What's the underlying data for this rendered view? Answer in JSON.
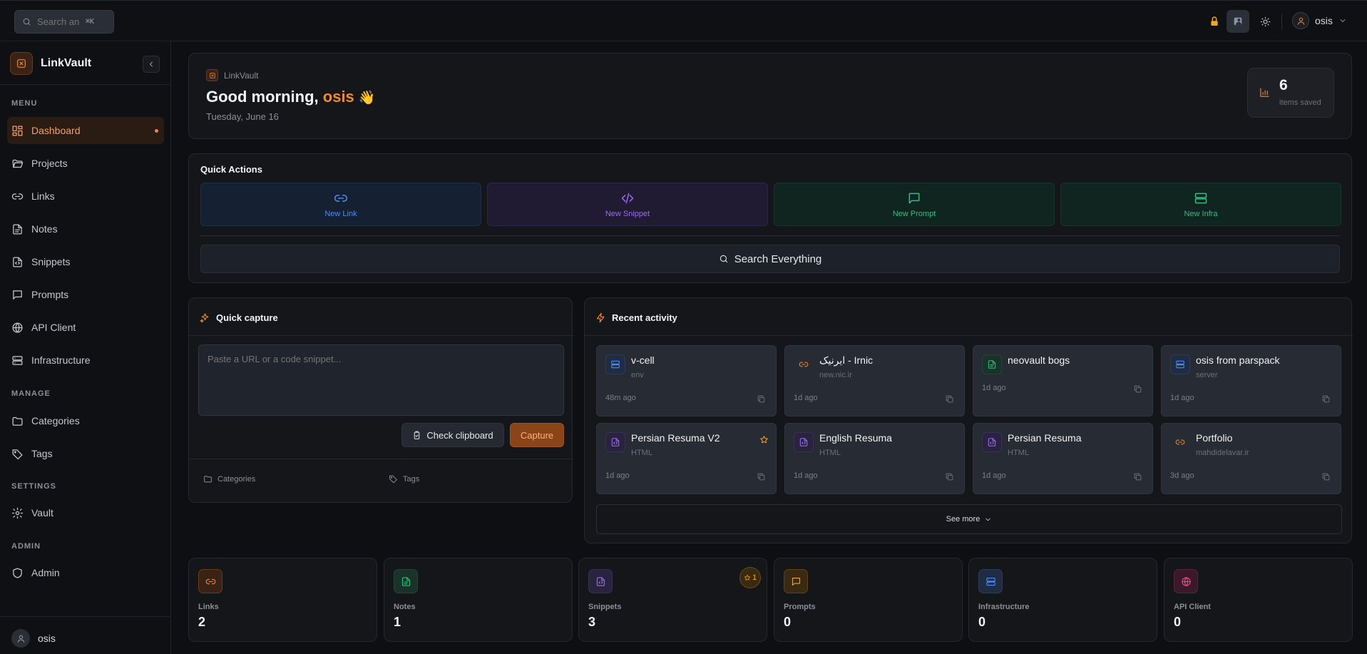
{
  "topbar": {
    "search_placeholder": "Search an",
    "search_kbd": "⌘K",
    "user_name": "osis"
  },
  "sidebar": {
    "brand": "LinkVault",
    "sections": {
      "menu": "MENU",
      "manage": "MANAGE",
      "settings": "SETTINGS",
      "admin": "ADMIN"
    },
    "items": {
      "dashboard": "Dashboard",
      "projects": "Projects",
      "links": "Links",
      "notes": "Notes",
      "snippets": "Snippets",
      "prompts": "Prompts",
      "api_client": "API Client",
      "infrastructure": "Infrastructure",
      "categories": "Categories",
      "tags": "Tags",
      "vault": "Vault",
      "admin": "Admin"
    },
    "user_name": "osis"
  },
  "hero": {
    "crumb": "LinkVault",
    "greeting": "Good morning, ",
    "name": "osis",
    "wave": "👋",
    "date": "Tuesday, June 16",
    "saved_count": "6",
    "saved_label": "items saved"
  },
  "quick_actions": {
    "title": "Quick Actions",
    "new_link": "New Link",
    "new_snippet": "New Snippet",
    "new_prompt": "New Prompt",
    "new_infra": "New Infra",
    "search_everything": "Search Everything"
  },
  "quick_capture": {
    "title": "Quick capture",
    "placeholder": "Paste a URL or a code snippet...",
    "check_clipboard": "Check clipboard",
    "capture": "Capture",
    "categories": "Categories",
    "tags": "Tags"
  },
  "recent_activity": {
    "title": "Recent activity",
    "items": [
      {
        "title": "v-cell",
        "sub": "env",
        "time": "48m ago",
        "icon": "server-icon",
        "color": "blue"
      },
      {
        "title": "ایرنیک - Irnic",
        "sub": "new.nic.ir",
        "time": "1d ago",
        "icon": "link-icon",
        "color": "orange"
      },
      {
        "title": "neovault bogs",
        "sub": "",
        "time": "1d ago",
        "icon": "document-icon",
        "color": "green"
      },
      {
        "title": "osis from parspack",
        "sub": "server",
        "time": "1d ago",
        "icon": "server-icon",
        "color": "blue"
      },
      {
        "title": "Persian Resuma V2",
        "sub": "HTML",
        "time": "1d ago",
        "icon": "code-file-icon",
        "color": "purple",
        "starred": true
      },
      {
        "title": "English Resuma",
        "sub": "HTML",
        "time": "1d ago",
        "icon": "code-file-icon",
        "color": "purple"
      },
      {
        "title": "Persian Resuma",
        "sub": "HTML",
        "time": "1d ago",
        "icon": "code-file-icon",
        "color": "purple"
      },
      {
        "title": "Portfolio",
        "sub": "mahdidelavar.ir",
        "time": "3d ago",
        "icon": "link-icon",
        "color": "orange"
      }
    ],
    "see_more": "See more"
  },
  "stats": [
    {
      "label": "Links",
      "value": "2",
      "icon": "link-icon",
      "color": "orange"
    },
    {
      "label": "Notes",
      "value": "1",
      "icon": "document-icon",
      "color": "green"
    },
    {
      "label": "Snippets",
      "value": "3",
      "icon": "code-file-icon",
      "color": "purple",
      "badge": "1"
    },
    {
      "label": "Prompts",
      "value": "0",
      "icon": "chat-icon",
      "color": "amber"
    },
    {
      "label": "Infrastructure",
      "value": "0",
      "icon": "server-icon",
      "color": "blue"
    },
    {
      "label": "API Client",
      "value": "0",
      "icon": "globe-icon",
      "color": "pink"
    }
  ],
  "colors": {
    "accent": "#f08a30",
    "background": "#0e0f12",
    "panel": "#14161a"
  }
}
